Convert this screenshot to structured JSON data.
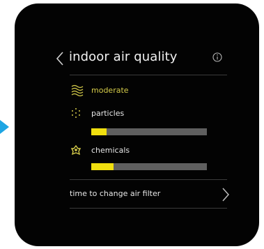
{
  "header": {
    "title": "indoor air quality"
  },
  "quality": {
    "label": "moderate"
  },
  "particles": {
    "label": "particles",
    "level": 0.13
  },
  "chemicals": {
    "label": "chemicals",
    "level": 0.19
  },
  "filter": {
    "label": "time to change air filter"
  },
  "colors": {
    "accent": "#f0df0f",
    "quality_text": "#d6cc4a",
    "pointer": "#1ea5e3"
  }
}
